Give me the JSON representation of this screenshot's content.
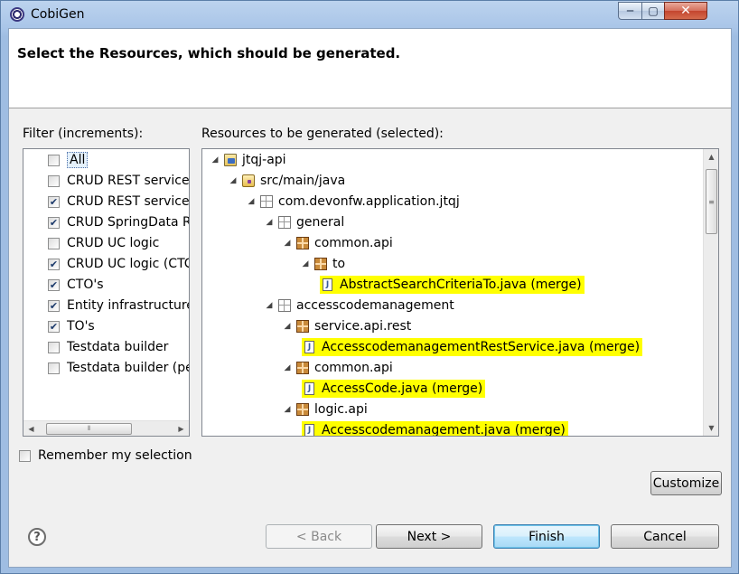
{
  "window": {
    "title": "CobiGen",
    "min_glyph": "─",
    "max_glyph": "▢",
    "close_glyph": "✕"
  },
  "banner": {
    "title": "Select the Resources, which should be generated."
  },
  "filter": {
    "label": "Filter (increments):",
    "items": [
      {
        "label": "All",
        "checked": false
      },
      {
        "label": "CRUD REST services",
        "checked": false
      },
      {
        "label": "CRUD REST services",
        "checked": true
      },
      {
        "label": "CRUD SpringData R",
        "checked": true
      },
      {
        "label": "CRUD UC logic",
        "checked": false
      },
      {
        "label": "CRUD UC logic (CTC",
        "checked": true
      },
      {
        "label": "CTO's",
        "checked": true
      },
      {
        "label": "Entity infrastructure",
        "checked": true
      },
      {
        "label": "TO's",
        "checked": true
      },
      {
        "label": "Testdata builder",
        "checked": false
      },
      {
        "label": "Testdata builder (pe",
        "checked": false
      }
    ]
  },
  "resources": {
    "label": "Resources to be generated (selected):",
    "nodes": [
      {
        "label": "jtqj-api",
        "icon": "project-icon",
        "depth": 0,
        "highlight": false
      },
      {
        "label": "src/main/java",
        "icon": "source-folder-icon",
        "depth": 1,
        "highlight": false
      },
      {
        "label": "com.devonfw.application.jtqj",
        "icon": "empty-package-icon",
        "depth": 2,
        "highlight": false
      },
      {
        "label": "general",
        "icon": "empty-package-icon",
        "depth": 3,
        "highlight": false
      },
      {
        "label": "common.api",
        "icon": "package-icon",
        "depth": 4,
        "highlight": false
      },
      {
        "label": "to",
        "icon": "package-icon",
        "depth": 5,
        "highlight": false
      },
      {
        "label": "AbstractSearchCriteriaTo.java (merge)",
        "icon": "java-file-icon",
        "depth": 6,
        "highlight": true
      },
      {
        "label": "accesscodemanagement",
        "icon": "empty-package-icon",
        "depth": 3,
        "highlight": false
      },
      {
        "label": "service.api.rest",
        "icon": "package-icon",
        "depth": 4,
        "highlight": false
      },
      {
        "label": "AccesscodemanagementRestService.java (merge)",
        "icon": "java-file-icon",
        "depth": 5,
        "highlight": true
      },
      {
        "label": "common.api",
        "icon": "package-icon",
        "depth": 4,
        "highlight": false
      },
      {
        "label": "AccessCode.java (merge)",
        "icon": "java-file-icon",
        "depth": 5,
        "highlight": true
      },
      {
        "label": "logic.api",
        "icon": "package-icon",
        "depth": 4,
        "highlight": false
      },
      {
        "label": "Accesscodemanagement.java (merge)",
        "icon": "java-file-icon",
        "depth": 5,
        "highlight": true
      }
    ]
  },
  "remember": {
    "label": "Remember my selection",
    "checked": false
  },
  "buttons": {
    "customize": "Customize",
    "back": "< Back",
    "next": "Next >",
    "finish": "Finish",
    "cancel": "Cancel"
  },
  "colors": {
    "highlight": "#ffff00",
    "titlebar": "#a9c5e8",
    "close": "#c4452f"
  }
}
